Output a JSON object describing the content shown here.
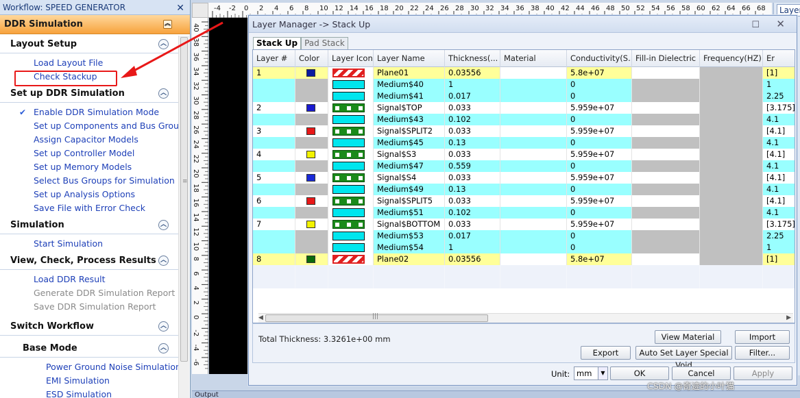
{
  "workflow": {
    "title": "Workflow: SPEED GENERATOR",
    "header": "DDR Simulation",
    "sections": [
      {
        "name": "layout-setup",
        "title": "Layout Setup",
        "sub": false,
        "items": [
          {
            "label": "Load Layout File",
            "enabled": true,
            "checked": false
          },
          {
            "label": "Check Stackup",
            "enabled": true,
            "checked": false
          }
        ]
      },
      {
        "name": "setup-ddr",
        "title": "Set up DDR Simulation",
        "sub": false,
        "items": [
          {
            "label": "Enable DDR Simulation Mode",
            "enabled": true,
            "checked": true
          },
          {
            "label": "Set up Components and Bus Groups",
            "enabled": true,
            "checked": false
          },
          {
            "label": "Assign Capacitor Models",
            "enabled": true,
            "checked": false
          },
          {
            "label": "Set up Controller Model",
            "enabled": true,
            "checked": false
          },
          {
            "label": "Set up Memory Models",
            "enabled": true,
            "checked": false
          },
          {
            "label": "Select Bus Groups for Simulation",
            "enabled": true,
            "checked": false
          },
          {
            "label": "Set up Analysis Options",
            "enabled": true,
            "checked": false
          },
          {
            "label": "Save File with Error Check",
            "enabled": true,
            "checked": false
          }
        ]
      },
      {
        "name": "simulation",
        "title": "Simulation",
        "sub": false,
        "items": [
          {
            "label": "Start Simulation",
            "enabled": true,
            "checked": false
          }
        ]
      },
      {
        "name": "results",
        "title": "View, Check, Process Results",
        "sub": false,
        "items": [
          {
            "label": "Load DDR Result",
            "enabled": true,
            "checked": false
          },
          {
            "label": "Generate DDR Simulation Report",
            "enabled": false,
            "checked": false
          },
          {
            "label": "Save DDR Simulation Report",
            "enabled": false,
            "checked": false
          }
        ]
      },
      {
        "name": "switch-workflow",
        "title": "Switch Workflow",
        "sub": false,
        "items": []
      },
      {
        "name": "base-mode",
        "title": "Base Mode",
        "sub": true,
        "items": [
          {
            "label": "Power Ground Noise Simulation",
            "enabled": true,
            "checked": false
          },
          {
            "label": "EMI Simulation",
            "enabled": true,
            "checked": false
          },
          {
            "label": "ESD Simulation",
            "enabled": true,
            "checked": false
          }
        ]
      }
    ]
  },
  "ruler": {
    "h_ticks": [
      "-4",
      "-2",
      "0",
      "2",
      "4",
      "6",
      "8",
      "10",
      "12",
      "14",
      "16",
      "18",
      "20",
      "22",
      "24",
      "26",
      "28",
      "30",
      "32",
      "34",
      "36",
      "38",
      "40",
      "42",
      "44",
      "46",
      "48",
      "50",
      "52",
      "54",
      "56",
      "58",
      "60",
      "62",
      "64",
      "66",
      "68"
    ],
    "v_ticks": [
      "40",
      "38",
      "36",
      "34",
      "32",
      "30",
      "28",
      "26",
      "24",
      "22",
      "20",
      "18",
      "16",
      "14",
      "12",
      "10",
      "8",
      "6",
      "4",
      "2",
      "0",
      "-2",
      "-4",
      "-6"
    ]
  },
  "right_panel": {
    "tab": "Layer"
  },
  "output_label": "Output",
  "dialog": {
    "title": "Layer Manager -> Stack Up",
    "tabs": [
      "Stack Up",
      "Pad Stack"
    ],
    "columns": [
      "Layer #",
      "Color",
      "Layer Icon",
      "Layer Name",
      "Thickness(...",
      "Material",
      "Conductivity(S...",
      "Fill-in Dielectric",
      "Frequency(HZ)",
      "Er"
    ],
    "rows": [
      {
        "num": "1",
        "color": "#0a1aa0",
        "icon": "plane",
        "name": "Plane01",
        "thickness": "0.03556",
        "material": "",
        "conductivity": "5.8e+07",
        "er": "[1]",
        "kind": "plane"
      },
      {
        "num": "",
        "color": "",
        "icon": "diel",
        "name": "Medium$40",
        "thickness": "1",
        "material": "",
        "conductivity": "0",
        "er": "1",
        "kind": "medium"
      },
      {
        "num": "",
        "color": "",
        "icon": "diel",
        "name": "Medium$41",
        "thickness": "0.017",
        "material": "",
        "conductivity": "0",
        "er": "2.25",
        "kind": "medium"
      },
      {
        "num": "2",
        "color": "#1a1ad0",
        "icon": "sig",
        "name": "Signal$TOP",
        "thickness": "0.033",
        "material": "",
        "conductivity": "5.959e+07",
        "er": "[3.175]",
        "kind": "signal"
      },
      {
        "num": "",
        "color": "",
        "icon": "diel",
        "name": "Medium$43",
        "thickness": "0.102",
        "material": "",
        "conductivity": "0",
        "er": "4.1",
        "kind": "medium"
      },
      {
        "num": "3",
        "color": "#e81818",
        "icon": "sig",
        "name": "Signal$SPLIT2",
        "thickness": "0.033",
        "material": "",
        "conductivity": "5.959e+07",
        "er": "[4.1]",
        "kind": "signal"
      },
      {
        "num": "",
        "color": "",
        "icon": "diel",
        "name": "Medium$45",
        "thickness": "0.13",
        "material": "",
        "conductivity": "0",
        "er": "4.1",
        "kind": "medium"
      },
      {
        "num": "4",
        "color": "#f2f200",
        "icon": "sig",
        "name": "Signal$S3",
        "thickness": "0.033",
        "material": "",
        "conductivity": "5.959e+07",
        "er": "[4.1]",
        "kind": "signal"
      },
      {
        "num": "",
        "color": "",
        "icon": "diel",
        "name": "Medium$47",
        "thickness": "0.559",
        "material": "",
        "conductivity": "0",
        "er": "4.1",
        "kind": "medium"
      },
      {
        "num": "5",
        "color": "#1a2ad8",
        "icon": "sig",
        "name": "Signal$S4",
        "thickness": "0.033",
        "material": "",
        "conductivity": "5.959e+07",
        "er": "[4.1]",
        "kind": "signal"
      },
      {
        "num": "",
        "color": "",
        "icon": "diel",
        "name": "Medium$49",
        "thickness": "0.13",
        "material": "",
        "conductivity": "0",
        "er": "4.1",
        "kind": "medium"
      },
      {
        "num": "6",
        "color": "#e81818",
        "icon": "sig",
        "name": "Signal$SPLIT5",
        "thickness": "0.033",
        "material": "",
        "conductivity": "5.959e+07",
        "er": "[4.1]",
        "kind": "signal"
      },
      {
        "num": "",
        "color": "",
        "icon": "diel",
        "name": "Medium$51",
        "thickness": "0.102",
        "material": "",
        "conductivity": "0",
        "er": "4.1",
        "kind": "medium"
      },
      {
        "num": "7",
        "color": "#f2f200",
        "icon": "sig",
        "name": "Signal$BOTTOM",
        "thickness": "0.033",
        "material": "",
        "conductivity": "5.959e+07",
        "er": "[3.175]",
        "kind": "signal"
      },
      {
        "num": "",
        "color": "",
        "icon": "diel",
        "name": "Medium$53",
        "thickness": "0.017",
        "material": "",
        "conductivity": "0",
        "er": "2.25",
        "kind": "medium"
      },
      {
        "num": "",
        "color": "",
        "icon": "diel",
        "name": "Medium$54",
        "thickness": "1",
        "material": "",
        "conductivity": "0",
        "er": "1",
        "kind": "medium"
      },
      {
        "num": "8",
        "color": "#0a6a0a",
        "icon": "plane",
        "name": "Plane02",
        "thickness": "0.03556",
        "material": "",
        "conductivity": "5.8e+07",
        "er": "[1]",
        "kind": "plane"
      }
    ],
    "total_label": "Total Thickness:",
    "total_value": "3.3261e+00 mm",
    "buttons": {
      "view_material": "View Material",
      "import": "Import",
      "export": "Export",
      "auto_set": "Auto Set Layer Special Void",
      "filter": "Filter...",
      "ok": "OK",
      "cancel": "Cancel",
      "apply": "Apply"
    },
    "unit_label": "Unit:",
    "unit_value": "mm"
  },
  "watermark": "CSDN @奇迹的小叶猫",
  "colors": {
    "plane_row": "#ffff99",
    "medium_row": "#99ffff",
    "signal_row": "#ffffff",
    "gray_cell": "#c0c0c0",
    "callout": "#e81818",
    "link": "#1e40b8"
  }
}
